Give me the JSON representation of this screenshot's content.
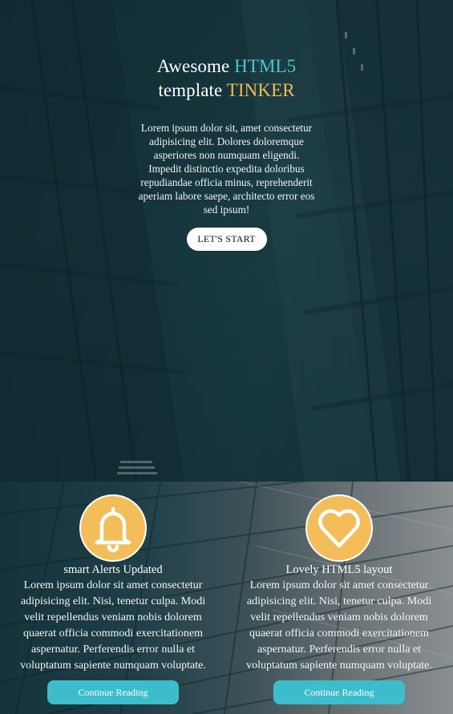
{
  "hero": {
    "title_line1_prefix": "Awesome ",
    "title_line1_accent": "HTML5",
    "title_line2_prefix": "template ",
    "title_line2_accent": "TINKER",
    "description": "Lorem ipsum dolor sit, amet consectetur adipisicing elit. Dolores doloremque asperiores non numquam eligendi. Impedit distinctio expedita doloribus repudiandae officia minus, reprehenderit aperiam labore saepe, architecto error eos sed ipsum!",
    "cta_label": "LET'S START"
  },
  "features": [
    {
      "icon": "bell-icon",
      "title": "smart Alerts Updated",
      "text": "Lorem ipsum dolor sit amet consectetur adipisicing elit. Nisi, tenetur culpa. Modi velit repellendus veniam nobis dolorem quaerat officia commodi exercitationem aspernatur. Perferendis error nulla et voluptatum sapiente numquam voluptate.",
      "button_label": "Continue Reading"
    },
    {
      "icon": "heart-icon",
      "title": "Lovely HTML5 layout",
      "text": "Lorem ipsum dolor sit amet consectetur adipisicing elit. Nisi, tenetur culpa. Modi velit repellendus veniam nobis dolorem quaerat officia commodi exercitationem aspernatur. Perferendis error nulla et voluptatum sapiente numquam voluptate.",
      "button_label": "Continue Reading"
    }
  ],
  "colors": {
    "accent_blue": "#4ec3cf",
    "accent_yellow": "#f2bb57",
    "icon_circle": "#f3be5a",
    "button_teal": "#3dbdcb"
  }
}
